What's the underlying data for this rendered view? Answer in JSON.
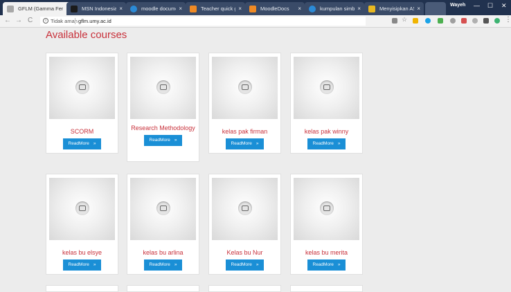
{
  "browser": {
    "tabs": [
      {
        "label": "GFLM (Gamma Fer",
        "favicon_color": "#a8a8a8",
        "active": true
      },
      {
        "label": "MSN Indonesia | T",
        "favicon_color": "#1b1b1b",
        "active": false
      },
      {
        "label": "moodle documen",
        "favicon_color": "#2b8ad6",
        "active": false
      },
      {
        "label": "Teacher quick gui",
        "favicon_color": "#f08a24",
        "active": false
      },
      {
        "label": "MoodleDocs",
        "favicon_color": "#f08a24",
        "active": false
      },
      {
        "label": "kumpulan simbol",
        "favicon_color": "#2b8ad6",
        "active": false
      },
      {
        "label": "Menyisipkan ASCI",
        "favicon_color": "#e8b820",
        "active": false
      },
      {
        "label": "",
        "favicon_color": "#4a5b78",
        "active": false
      }
    ],
    "tab_close_glyph": "×",
    "profile": "Wayeh",
    "window": {
      "minimize": "—",
      "maximize": "☐",
      "close": "✕"
    },
    "nav": {
      "back": "←",
      "forward": "→",
      "reload": "C"
    },
    "address": {
      "security_label": "Tidak aman",
      "url": "gflm.umy.ac.id"
    },
    "extension_colors": [
      "#888888",
      "#f0b400",
      "#1aa3e8",
      "#1aa3e8",
      "#4caf50",
      "#9e9e9e",
      "#d65050",
      "#b0b0b0",
      "#555555",
      "#3cb371"
    ],
    "menu_glyph": "⋮"
  },
  "page": {
    "title": "Available courses",
    "accent_color": "#c8303a",
    "button_color": "#1a8fd6",
    "courses": [
      {
        "name": "SCORM",
        "button": "ReadMore",
        "arrow": "»"
      },
      {
        "name": "Research Methodology",
        "button": "ReadMore",
        "arrow": "»"
      },
      {
        "name": "kelas pak firman",
        "button": "ReadMore",
        "arrow": "»"
      },
      {
        "name": "kelas pak winny",
        "button": "ReadMore",
        "arrow": "»"
      },
      {
        "name": "kelas bu elsye",
        "button": "ReadMore",
        "arrow": "»"
      },
      {
        "name": "kelas bu arlina",
        "button": "ReadMore",
        "arrow": "»"
      },
      {
        "name": "Kelas bu Nur",
        "button": "ReadMore",
        "arrow": "»"
      },
      {
        "name": "kelas bu merita",
        "button": "ReadMore",
        "arrow": "»"
      }
    ]
  }
}
